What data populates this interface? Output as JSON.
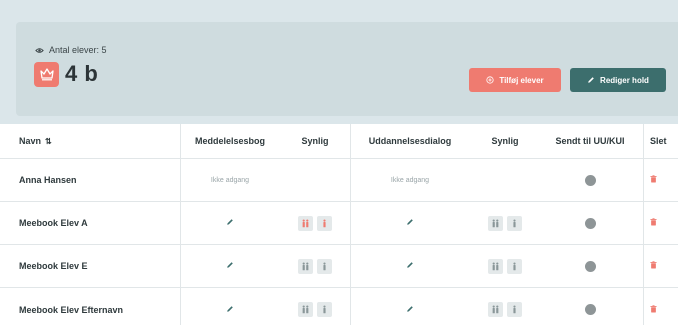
{
  "header": {
    "student_count_label": "Antal elever: 5",
    "class_name": "4 b",
    "add_students_label": "Tilføj elever",
    "edit_group_label": "Rediger hold"
  },
  "table": {
    "columns": {
      "name": "Navn",
      "message_book": "Meddelelsesbog",
      "visible_1": "Synlig",
      "education_dialog": "Uddannelsesdialog",
      "visible_2": "Synlig",
      "sent_to": "Sendt til UU/KUI",
      "delete": "Slet"
    },
    "no_access_label": "Ikke adgang",
    "rows": [
      {
        "name": "Anna Hansen",
        "access": false,
        "visible1_active": false,
        "visible2_active": false
      },
      {
        "name": "Meebook Elev A",
        "access": true,
        "visible1_active": true,
        "visible2_active": false
      },
      {
        "name": "Meebook Elev E",
        "access": true,
        "visible1_active": false,
        "visible2_active": false
      },
      {
        "name": "Meebook Elev Efternavn",
        "access": true,
        "visible1_active": false,
        "visible2_active": false
      }
    ]
  },
  "colors": {
    "accent": "#ef7b70",
    "primary": "#3c6e6d",
    "inactive_chip": "#8a9799",
    "pencil": "#3c6e6d",
    "sent_dot": "#8e9597"
  },
  "icons": {
    "count": "eye-icon",
    "class_badge": "crown-icon",
    "add": "plus-circle-icon",
    "edit": "pencil-icon",
    "sort": "sort-icon",
    "visible_pair": "parents-icon",
    "visible_single": "person-icon",
    "delete": "trash-icon"
  }
}
